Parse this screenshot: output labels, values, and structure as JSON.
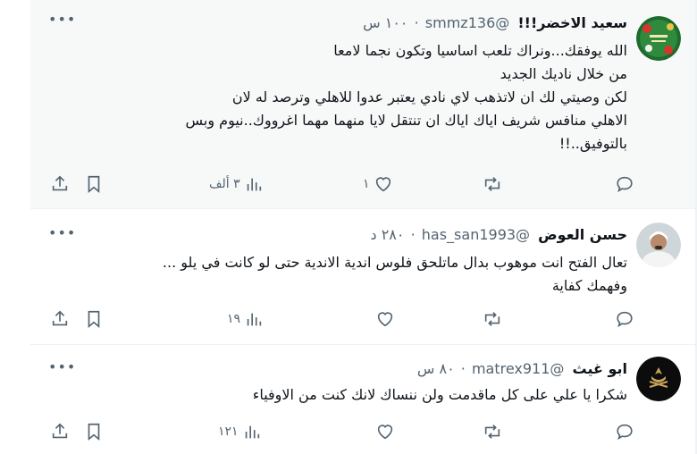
{
  "tweets": [
    {
      "name": "سعيد الاخضر!!!",
      "handle": "@smmz136",
      "time": "١٠٠ س",
      "lines": [
        "الله يوفقك...ونراك تلعب اساسيا وتكون نجما لامعا",
        "من خلال ناديك الجديد",
        "لكن وصيتي لك ان لاتذهب لاي نادي يعتبر عدوا للاهلي وترصد له لان",
        "الاهلي منافس شريف اياك اياك ان تنتقل لايا منهما مهما اغرووك..نيوم وبس",
        "بالتوفيق..!!"
      ],
      "views": "٣ ألف",
      "likes": "١",
      "retweets": "",
      "replies": ""
    },
    {
      "name": "حسن العوض",
      "handle": "@has_san1993",
      "time": "٢٨٠ د",
      "lines": [
        "تعال الفتح انت موهوب بدال ماتلحق فلوس اندية الاندية حتى لو كانت في يلو ...",
        "وفهمك كفاية"
      ],
      "views": "١٩",
      "likes": "",
      "retweets": "",
      "replies": ""
    },
    {
      "name": "ابو غيث",
      "handle": "@matrex911",
      "time": "٨٠ س",
      "lines": [
        "شكرا يا علي على كل ماقدمت ولن ننساك لانك كنت من الاوفياء"
      ],
      "views": "١٢١",
      "likes": "",
      "retweets": "",
      "replies": ""
    }
  ],
  "icons": {
    "more": "more-dots-icon",
    "share": "share-icon",
    "bookmark": "bookmark-icon",
    "views": "views-chart-icon",
    "like": "heart-icon",
    "retweet": "retweet-icon",
    "reply": "reply-icon"
  },
  "colors": {
    "text": "#0f1419",
    "muted": "#536471",
    "border": "#eff3f4",
    "highlight": "#f7f9f9"
  }
}
